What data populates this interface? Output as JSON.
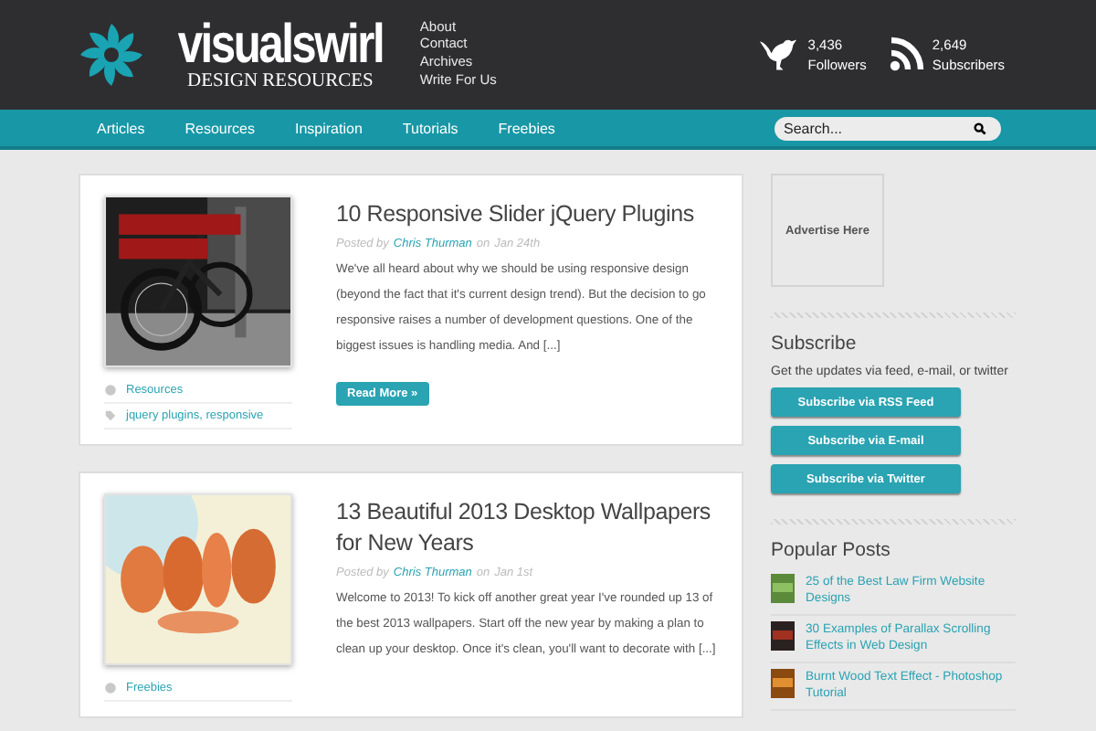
{
  "header": {
    "logo_name": "visualswirl",
    "logo_tagline": "DESIGN RESOURCES",
    "links": [
      "About",
      "Contact",
      "Archives",
      "Write For Us"
    ],
    "stats": [
      {
        "kind": "twitter",
        "count": "3,436",
        "label": "Followers"
      },
      {
        "kind": "rss",
        "count": "2,649",
        "label": "Subscribers"
      }
    ]
  },
  "nav": {
    "items": [
      "Articles",
      "Resources",
      "Inspiration",
      "Tutorials",
      "Freebies"
    ],
    "search": {
      "placeholder": "Search..."
    }
  },
  "posts": [
    {
      "title": "10 Responsive Slider jQuery Plugins",
      "posted_by": "Posted by",
      "author": "Chris Thurman",
      "on": "on",
      "date": "Jan 24th",
      "excerpt": "We've all heard about why we should be using responsive design (beyond the fact that it's current design trend). But the decision to go responsive raises a number of development questions. One of the biggest issues is handling media. And [...]",
      "read_more": "Read More »",
      "meta": [
        {
          "kind": "category",
          "text": "Resources"
        },
        {
          "kind": "tags",
          "text": "jquery plugins, responsive"
        }
      ]
    },
    {
      "title": "13 Beautiful 2013 Desktop Wallpapers for New Years",
      "posted_by": "Posted by",
      "author": "Chris Thurman",
      "on": "on",
      "date": "Jan 1st",
      "excerpt": "Welcome to 2013! To kick off another great  year I've rounded up 13 of the best 2013 wallpapers. Start off the new year by making a plan to clean up your desktop. Once it's clean, you'll want to decorate with [...]",
      "meta": [
        {
          "kind": "category",
          "text": "Freebies"
        }
      ]
    }
  ],
  "sidebar": {
    "ad": "Advertise Here",
    "subscribe": {
      "title": "Subscribe",
      "text": "Get the updates via feed, e-mail, or twitter",
      "buttons": [
        "Subscribe via RSS Feed",
        "Subscribe via E-mail",
        "Subscribe via Twitter"
      ]
    },
    "popular": {
      "title": "Popular Posts",
      "items": [
        "25 of the Best Law Firm Website Designs",
        "30 Examples of Parallax Scrolling Effects in Web Design",
        "Burnt Wood Text Effect - Photoshop Tutorial"
      ]
    }
  }
}
